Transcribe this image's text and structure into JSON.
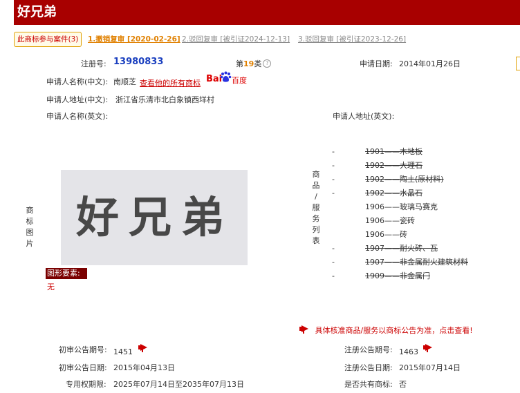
{
  "header": {
    "title": "好兄弟"
  },
  "tabs": [
    {
      "label": "此商标参与案件(3)"
    },
    {
      "label": "1.撤销复审 [2020-02-26]"
    },
    {
      "label": "2.驳回复审 [被引证2024-12-13]"
    },
    {
      "label": "3.驳回复审 [被引证2023-12-26]"
    }
  ],
  "info": {
    "reg_no_label": "注册号:",
    "reg_no": "13980833",
    "class_prefix": "第",
    "class_num": "19",
    "class_suffix": "类",
    "apply_date_label": "申请日期:",
    "apply_date": "2014年01月26日",
    "applicant_cn_label": "申请人名称(中文):",
    "applicant_cn": "南顺芝",
    "view_all_link": "查看他的所有商标",
    "baidu_bai": "Bai",
    "baidu_du": "百度",
    "address_cn_label": "申请人地址(中文):",
    "address_cn": "浙江省乐清市北白象镇西垟村",
    "applicant_en_label": "申请人名称(英文):",
    "address_en_label": "申请人地址(英文):"
  },
  "mark": {
    "side_label": [
      "商",
      "标",
      "图",
      "片"
    ],
    "image_text": "好兄弟",
    "element_label": "图形要素:",
    "element_value": "无"
  },
  "goods": {
    "side_label": [
      "商",
      "品",
      "/",
      "服",
      "务",
      "列",
      "表"
    ],
    "items": [
      {
        "dash": "-",
        "text": "1901——木地板",
        "struck": true
      },
      {
        "dash": "-",
        "text": "1902——大理石",
        "struck": true
      },
      {
        "dash": "-",
        "text": "1902——陶土(原材料)",
        "struck": true
      },
      {
        "dash": "-",
        "text": "1902——水晶石",
        "struck": true
      },
      {
        "dash": "",
        "text": "1906——玻璃马赛克",
        "struck": false
      },
      {
        "dash": "",
        "text": "1906——瓷砖",
        "struck": false
      },
      {
        "dash": "",
        "text": "1906——砖",
        "struck": false
      },
      {
        "dash": "-",
        "text": "1907——耐火砖、瓦",
        "struck": true
      },
      {
        "dash": "-",
        "text": "1907——非金属耐火建筑材料",
        "struck": true
      },
      {
        "dash": "-",
        "text": "1909——非金属门",
        "struck": true
      }
    ],
    "notice": "具体核准商品/服务以商标公告为准，点击查看!"
  },
  "announce": {
    "prelim_no_label": "初审公告期号:",
    "prelim_no": "1451",
    "reg_no_label": "注册公告期号:",
    "reg_no": "1463",
    "prelim_date_label": "初审公告日期:",
    "prelim_date": "2015年04月13日",
    "reg_date_label": "注册公告日期:",
    "reg_date": "2015年07月14日",
    "term_label": "专用权期限:",
    "term": "2025年07月14日至2035年07月13日",
    "shared_label": "是否共有商标:",
    "shared": "否"
  },
  "colors": {
    "header_bg": "#a80000",
    "accent_red": "#cc0000",
    "tab_orange": "#e08000",
    "reg_no_blue": "#1a3fbf"
  }
}
